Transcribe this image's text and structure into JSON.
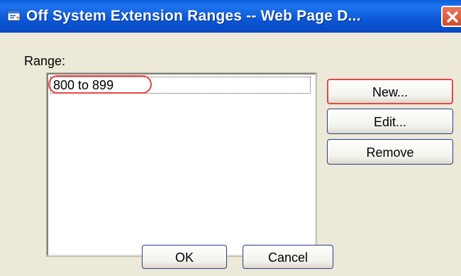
{
  "window": {
    "title": "Off System Extension Ranges -- Web Page D...",
    "icon": "dialog-window-icon",
    "close_icon": "close-icon"
  },
  "dialog": {
    "range_label": "Range:",
    "ranges": [
      {
        "label": "800 to 899",
        "selected": true
      }
    ],
    "buttons": {
      "new": "New...",
      "edit": "Edit...",
      "remove": "Remove",
      "ok": "OK",
      "cancel": "Cancel"
    }
  },
  "colors": {
    "titlebar": "#0c58d6",
    "dialog_bg": "#ece9d8",
    "highlight": "#e4474a",
    "close_button": "#d24d2a"
  }
}
